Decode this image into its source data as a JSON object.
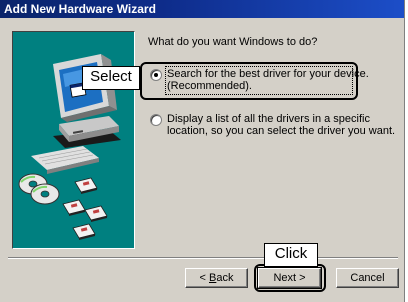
{
  "window": {
    "title": "Add New Hardware Wizard"
  },
  "main": {
    "prompt": "What do you want Windows to do?",
    "options": [
      {
        "line1": "Search for the best driver for your device.",
        "line2": "(Recommended).",
        "selected": true
      },
      {
        "line1": "Display a list of all the drivers in a specific",
        "line2": "location, so you can select the driver you want.",
        "selected": false
      }
    ]
  },
  "annotations": {
    "select_label": "Select",
    "click_label": "Click"
  },
  "buttons": {
    "back_prefix": "< ",
    "back_mnemonic": "B",
    "back_rest": "ack",
    "next_label": "Next >",
    "cancel_label": "Cancel"
  },
  "colors": {
    "titlebar": "#0a246a",
    "panel": "#008080",
    "dialog": "#d4d0c8"
  },
  "icons": {
    "artwork": "computer-with-disks-illustration"
  }
}
